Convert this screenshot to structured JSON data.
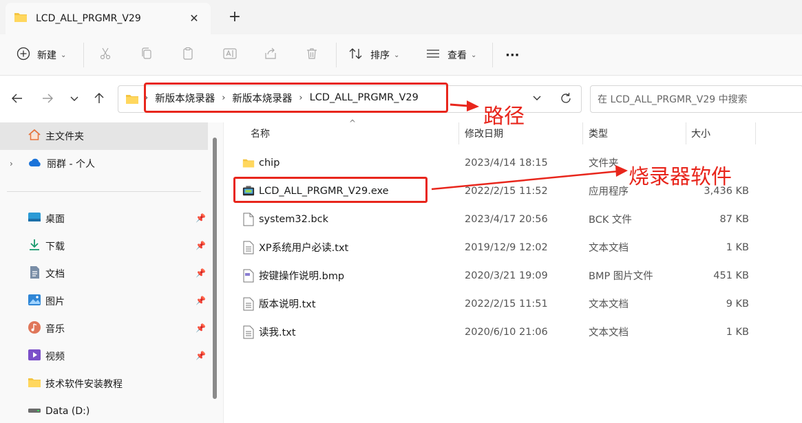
{
  "window": {
    "tab_title": "LCD_ALL_PRGMR_V29",
    "close_symbol": "✕",
    "new_tab_symbol": "+"
  },
  "toolbar": {
    "new_label": "新建",
    "sort_label": "排序",
    "view_label": "查看",
    "more_label": "···"
  },
  "address": {
    "crumbs": [
      "新版本烧录器",
      "新版本烧录器",
      "LCD_ALL_PRGMR_V29"
    ],
    "separator": "›",
    "search_placeholder": "在 LCD_ALL_PRGMR_V29 中搜索"
  },
  "sidebar": {
    "home": "主文件夹",
    "cloud": "丽群 - 个人",
    "quick": [
      {
        "label": "桌面",
        "icon": "desktop-icon"
      },
      {
        "label": "下载",
        "icon": "download-icon"
      },
      {
        "label": "文档",
        "icon": "document-icon"
      },
      {
        "label": "图片",
        "icon": "picture-icon"
      },
      {
        "label": "音乐",
        "icon": "music-icon"
      },
      {
        "label": "视频",
        "icon": "video-icon"
      }
    ],
    "folder": "技术软件安装教程",
    "drive": "Data (D:)"
  },
  "columns": {
    "name": "名称",
    "modified": "修改日期",
    "type": "类型",
    "size": "大小"
  },
  "files": [
    {
      "name": "chip",
      "modified": "2023/4/14 18:15",
      "type": "文件夹",
      "size": "",
      "icon": "folder-icon"
    },
    {
      "name": "LCD_ALL_PRGMR_V29.exe",
      "modified": "2022/2/15 11:52",
      "type": "应用程序",
      "size": "3,436 KB",
      "icon": "exe-icon"
    },
    {
      "name": "system32.bck",
      "modified": "2023/4/17 20:56",
      "type": "BCK 文件",
      "size": "87 KB",
      "icon": "file-icon"
    },
    {
      "name": "XP系统用户必读.txt",
      "modified": "2019/12/9 12:02",
      "type": "文本文档",
      "size": "1 KB",
      "icon": "text-file-icon"
    },
    {
      "name": "按键操作说明.bmp",
      "modified": "2020/3/21 19:09",
      "type": "BMP 图片文件",
      "size": "451 KB",
      "icon": "bmp-file-icon"
    },
    {
      "name": "版本说明.txt",
      "modified": "2022/2/15 11:51",
      "type": "文本文档",
      "size": "9 KB",
      "icon": "text-file-icon"
    },
    {
      "name": "读我.txt",
      "modified": "2020/6/10 21:06",
      "type": "文本文档",
      "size": "1 KB",
      "icon": "text-file-icon"
    }
  ],
  "annotations": {
    "path_label": "路径",
    "software_label": "烧录器软件",
    "color": "#e8261c"
  }
}
